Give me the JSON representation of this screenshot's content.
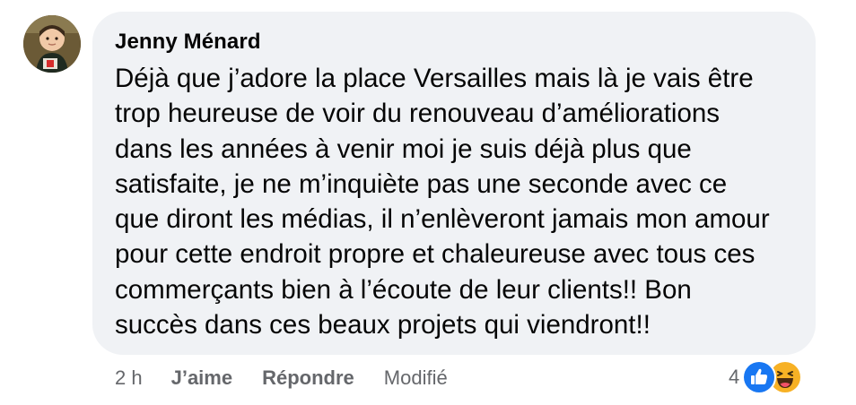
{
  "comment": {
    "author": "Jenny Ménard",
    "text_lines": [
      "Déjà que j’adore la place Versailles mais là je vais être",
      "trop heureuse de voir du renouveau d’améliorations",
      "dans les années à venir moi je suis déjà plus que",
      "satisfaite, je ne m’inquiète pas une seconde avec ce",
      "que diront les médias, il n’enlèveront jamais mon amour",
      "pour cette endroit propre et chaleureuse avec tous ces",
      "commerçants bien à l’écoute de leur clients!! Bon",
      "succès dans ces beaux projets qui viendront!!"
    ]
  },
  "actions": {
    "time": "2 h",
    "like_label": "J’aime",
    "reply_label": "Répondre",
    "edited_label": "Modifié"
  },
  "reactions": {
    "count": "4",
    "icons": [
      "like-icon",
      "haha-icon"
    ],
    "like_color": "#1877f2",
    "haha_color": "#f7b125"
  },
  "colors": {
    "bubble_bg": "#f0f2f5",
    "text": "#050505",
    "secondary_text": "#65676b"
  }
}
